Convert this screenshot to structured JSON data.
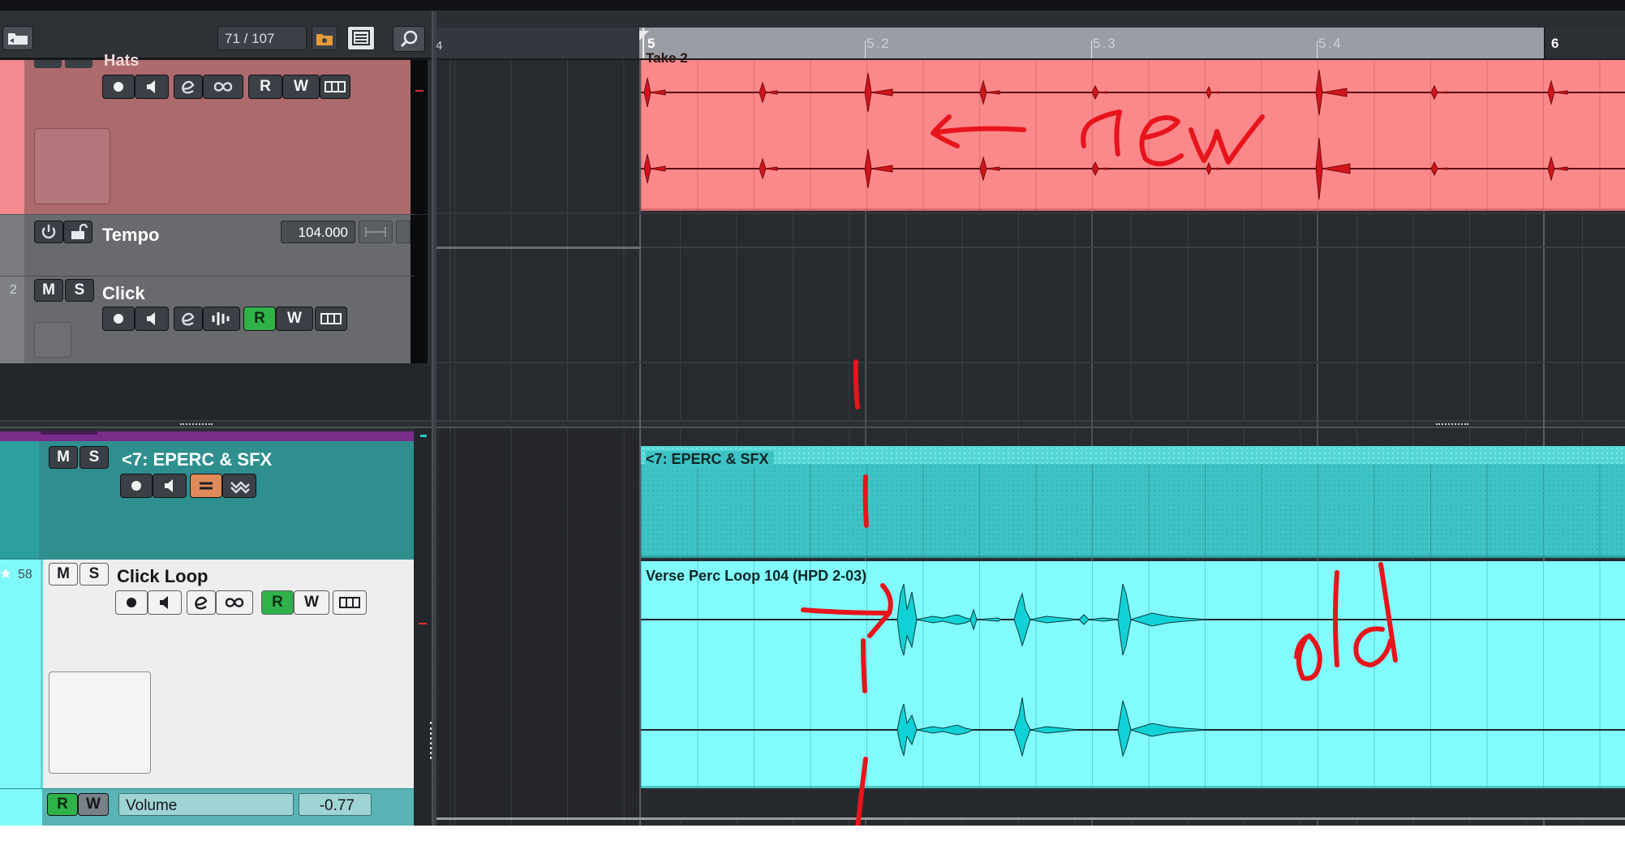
{
  "toolbar": {
    "track_counter": "71 / 107",
    "home_icon": "folder-up-icon",
    "search_icon": "search-icon"
  },
  "ruler": {
    "left_partial": "4",
    "marks": [
      "5",
      "5.2",
      "5.3",
      "5.4",
      "6"
    ]
  },
  "tracks": {
    "hats": {
      "name": "Hats",
      "event_name": "Take 2",
      "color": "#b06a6e"
    },
    "tempo": {
      "name": "Tempo",
      "value": "104.000"
    },
    "click": {
      "number": "2",
      "name": "Click",
      "mute": "M",
      "solo": "S",
      "read": "R",
      "write": "W"
    },
    "eperc": {
      "name": "<7: EPERC & SFX",
      "event_name": "<7: EPERC & SFX",
      "mute": "M",
      "solo": "S",
      "color": "#2f9a9a"
    },
    "click_loop": {
      "number": "58",
      "name": "Click Loop",
      "event_name": "Verse Perc Loop 104 (HPD 2-03)",
      "mute": "M",
      "solo": "S",
      "read": "R",
      "write": "W",
      "color": "#7ff9fa"
    },
    "automation": {
      "read": "R",
      "write": "W",
      "param": "Volume",
      "value": "-0.77"
    }
  },
  "annotations": {
    "new_label": "new",
    "old_label": "old"
  }
}
